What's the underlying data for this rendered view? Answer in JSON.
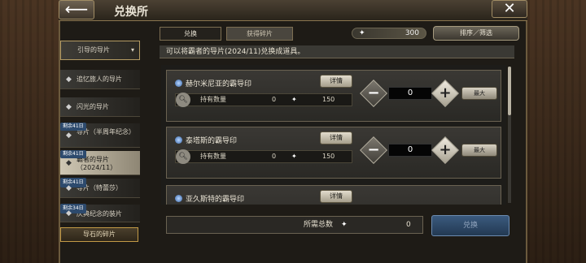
{
  "header": {
    "title": "兑换所",
    "back_icon": "back-arrow-icon",
    "close_icon": "close-icon"
  },
  "sidebar": {
    "items": [
      {
        "label": "引导的导片",
        "badge": ""
      },
      {
        "label": "追忆旅人的导片",
        "badge": ""
      },
      {
        "label": "闪光的导片",
        "badge": ""
      },
      {
        "label": "导片（半周年纪念）",
        "badge": "剩余41日"
      },
      {
        "label": "霸者的导片（2024/11）",
        "badge": "剩余41日"
      },
      {
        "label": "导片（特蕾莎）",
        "badge": "剩余41日"
      },
      {
        "label": "庆典纪念的装片",
        "badge": "剩余34日"
      }
    ],
    "bottom_label": "导石的碎片"
  },
  "tabs": [
    {
      "label": "兑换"
    },
    {
      "label": "获得碎片"
    }
  ],
  "currency": {
    "amount": "300"
  },
  "sort_label": "排序／筛选",
  "notice": "可以将霸者的导片(2024/11)兑换成道具。",
  "cards": [
    {
      "name": "赫尔米尼亚的霸导印",
      "detail": "详情",
      "hold_label": "持有数量",
      "owned": "0",
      "price": "150",
      "qty": "0",
      "max": "最大"
    },
    {
      "name": "泰塔斯的霸导印",
      "detail": "详情",
      "hold_label": "持有数量",
      "owned": "0",
      "price": "150",
      "qty": "0",
      "max": "最大"
    },
    {
      "name": "亚久斯特的霸导印",
      "detail": "详情",
      "hold_label": "",
      "owned": "",
      "price": "",
      "qty": "",
      "max": ""
    }
  ],
  "footer": {
    "total_label": "所需总数",
    "total_value": "0",
    "exchange_label": "兑换"
  }
}
